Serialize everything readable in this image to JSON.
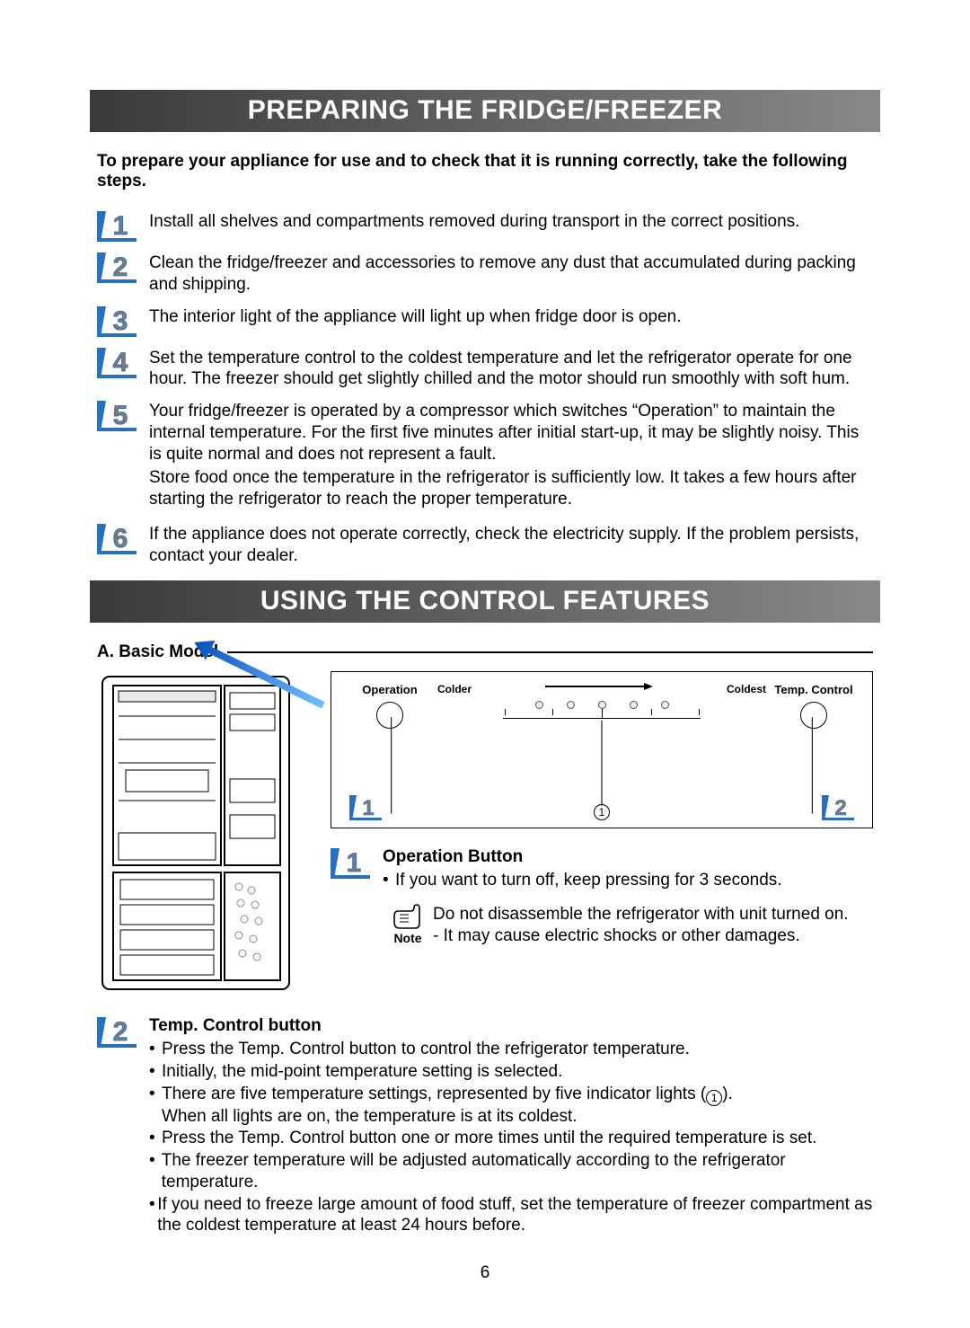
{
  "banner1": "PREPARING THE FRIDGE/FREEZER",
  "intro": "To prepare your appliance for use and to check that it is running correctly, take the following steps.",
  "steps": [
    "Install all shelves and compartments removed during transport in the correct positions.",
    "Clean the fridge/freezer and accessories to remove any dust that accumulated during packing and shipping.",
    "The interior light of the appliance will light up when fridge door is open.",
    "Set the temperature control to the coldest temperature and let the refrigerator operate for one hour. The freezer should get slightly chilled and the motor should run smoothly with soft hum.",
    "Your fridge/freezer is operated by a compressor which switches “Operation” to maintain the internal temperature. For the first five minutes after initial start-up, it may be slightly noisy. This is quite normal and does not represent a fault.\nStore food once the temperature in the refrigerator is sufficiently low. It takes a few hours after starting the refrigerator to reach the proper temperature.",
    "If the appliance does not operate correctly, check the electricity supply. If the problem persists, contact your dealer."
  ],
  "banner2": "USING THE CONTROL FEATURES",
  "model_a": {
    "heading": "A. Basic Model",
    "operation_label": "Operation",
    "temp_label": "Temp. Control",
    "colder": "Colder",
    "coldest": "Coldest"
  },
  "callout_numbers": {
    "one": "1",
    "two": "2",
    "circ1": "1"
  },
  "operation": {
    "title": "Operation Button",
    "bullet1": "If you want to turn off, keep pressing for 3 seconds.",
    "note_label": "Note",
    "note_line1": "Do not disassemble the refrigerator with unit turned on.",
    "note_line2": "- It may cause electric shocks or other damages."
  },
  "temp": {
    "title": "Temp. Control button",
    "b1": "Press the Temp. Control button to control the refrigerator temperature.",
    "b2": "Initially, the mid-point temperature setting is selected.",
    "b3a": "There are five temperature settings, represented by five indicator lights (",
    "b3b": ").",
    "b3c": "When all lights are on, the temperature is at its coldest.",
    "b4": "Press the Temp. Control button one or more times until the required temperature is set.",
    "b5": "The freezer temperature will be adjusted automatically according to the refrigerator temperature.",
    "b6": "If you need to freeze large amount of food stuff, set the temperature of freezer compartment as the coldest temperature at least 24 hours before."
  },
  "page_number": "6"
}
